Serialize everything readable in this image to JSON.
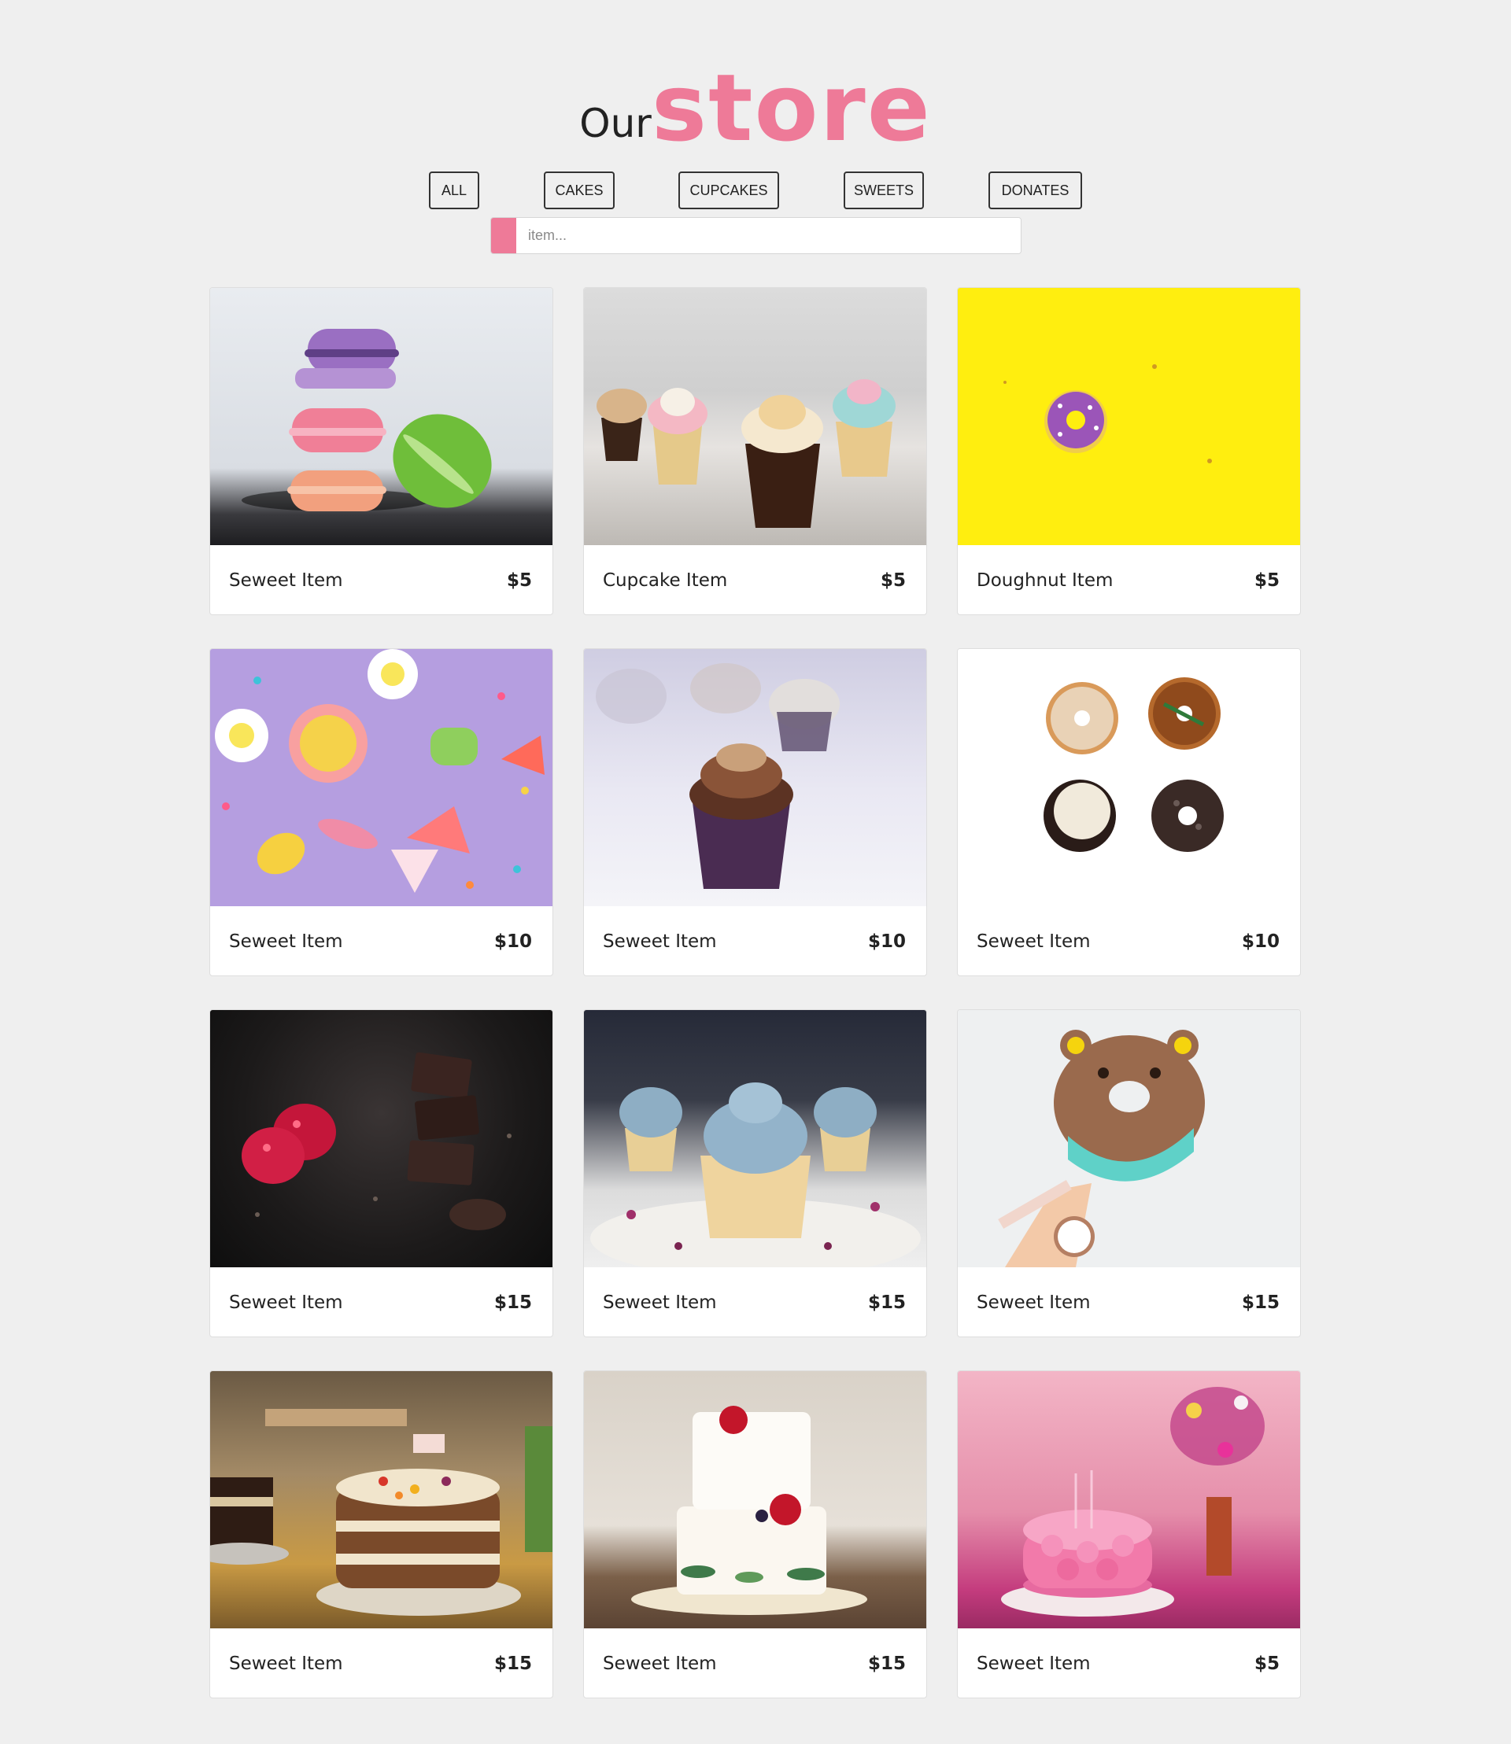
{
  "header": {
    "title_prefix": "Our",
    "title_main": "store"
  },
  "filters": [
    {
      "label": "ALL"
    },
    {
      "label": "CAKES"
    },
    {
      "label": "CUPCAKES"
    },
    {
      "label": "SWEETS"
    },
    {
      "label": "DONATES"
    }
  ],
  "search": {
    "placeholder": "item...",
    "value": "",
    "accent_color": "#ee7a98"
  },
  "items": [
    {
      "name": "Seweet Item",
      "price": "$5",
      "image": "macarons"
    },
    {
      "name": "Cupcake Item",
      "price": "$5",
      "image": "cupcakes"
    },
    {
      "name": "Doughnut Item",
      "price": "$5",
      "image": "doughnut-on-yellow"
    },
    {
      "name": "Seweet Item",
      "price": "$10",
      "image": "candies"
    },
    {
      "name": "Seweet Item",
      "price": "$10",
      "image": "chocolate-cupcake"
    },
    {
      "name": "Seweet Item",
      "price": "$10",
      "image": "four-doughnuts"
    },
    {
      "name": "Seweet Item",
      "price": "$15",
      "image": "chocolate-raspberries"
    },
    {
      "name": "Seweet Item",
      "price": "$15",
      "image": "blue-cupcakes"
    },
    {
      "name": "Seweet Item",
      "price": "$15",
      "image": "bear-doughnut"
    },
    {
      "name": "Seweet Item",
      "price": "$15",
      "image": "bakery-cakes"
    },
    {
      "name": "Seweet Item",
      "price": "$15",
      "image": "wedding-cake"
    },
    {
      "name": "Seweet Item",
      "price": "$5",
      "image": "pink-cake"
    }
  ],
  "colors": {
    "background": "#efefef",
    "accent": "#ee7a98",
    "card": "#ffffff"
  }
}
